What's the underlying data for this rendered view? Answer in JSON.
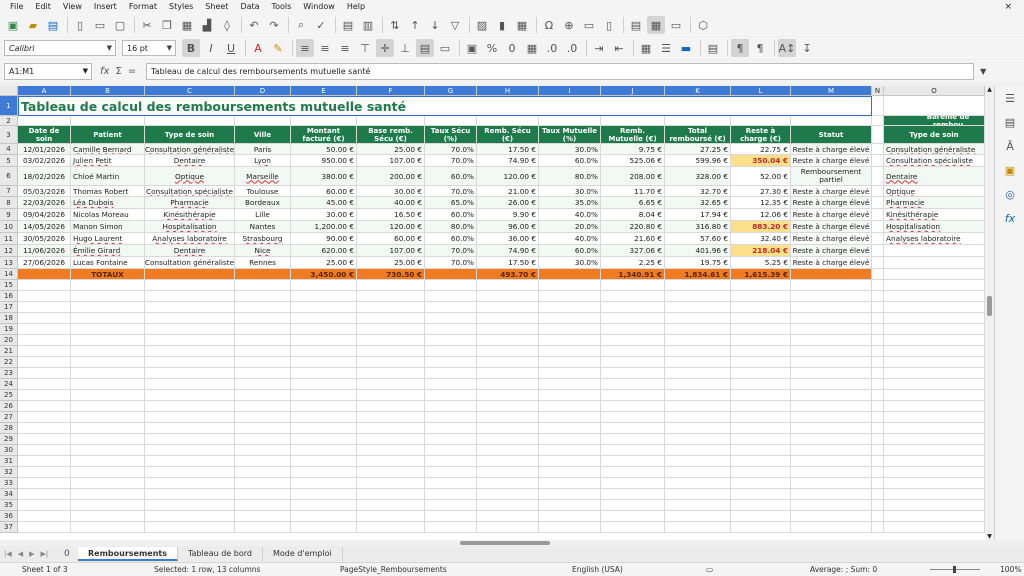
{
  "menu": [
    "File",
    "Edit",
    "View",
    "Insert",
    "Format",
    "Styles",
    "Sheet",
    "Data",
    "Tools",
    "Window",
    "Help"
  ],
  "menu_close": "×",
  "font_name": "Calibri",
  "font_size": "16 pt",
  "name_box": "A1:M1",
  "formula": "Tableau de calcul des remboursements mutuelle santé",
  "formula_icons": {
    "function_wizard": "fx",
    "sum": "Σ",
    "equals": "="
  },
  "columns": [
    "A",
    "B",
    "C",
    "D",
    "E",
    "F",
    "G",
    "H",
    "I",
    "J",
    "K",
    "L",
    "M",
    "N",
    "O"
  ],
  "row_numbers": [
    "1",
    "2",
    "3",
    "4",
    "5",
    "6",
    "7",
    "8",
    "9",
    "10",
    "11",
    "12",
    "13",
    "14",
    "15",
    "16",
    "17",
    "18",
    "19",
    "20",
    "21",
    "22",
    "23",
    "24",
    "25",
    "26",
    "27",
    "28",
    "29",
    "30",
    "31",
    "32",
    "33",
    "34",
    "35",
    "36",
    "37"
  ],
  "title": "Tableau de calcul des remboursements mutuelle santé",
  "headers": [
    "Date de soin",
    "Patient",
    "Type de soin",
    "Ville",
    "Montant facturé (€)",
    "Base remb. Sécu (€)",
    "Taux Sécu (%)",
    "Remb. Sécu (€)",
    "Taux Mutuelle (%)",
    "Remb. Mutuelle (€)",
    "Total remboursé (€)",
    "Reste à charge (€)",
    "Statut"
  ],
  "rows": [
    [
      "12/01/2026",
      "Camille Bernard",
      "Consultation généraliste",
      "Paris",
      "50.00 €",
      "25.00 €",
      "70.0%",
      "17.50 €",
      "30.0%",
      "9.75 €",
      "27.25 €",
      "22.75 €",
      "Reste à charge élevé"
    ],
    [
      "03/02/2026",
      "Julien Petit",
      "Dentaire",
      "Lyon",
      "950.00 €",
      "107.00 €",
      "70.0%",
      "74.90 €",
      "60.0%",
      "525.06 €",
      "599.96 €",
      "350.04 €",
      "Reste à charge élevé"
    ],
    [
      "18/02/2026",
      "Chloé Martin",
      "Optique",
      "Marseille",
      "380.00 €",
      "200.00 €",
      "60.0%",
      "120.00 €",
      "80.0%",
      "208.00 €",
      "328.00 €",
      "52.00 €",
      "Remboursement partiel"
    ],
    [
      "05/03/2026",
      "Thomas Robert",
      "Consultation spécialiste",
      "Toulouse",
      "60.00 €",
      "30.00 €",
      "70.0%",
      "21.00 €",
      "30.0%",
      "11.70 €",
      "32.70 €",
      "27.30 €",
      "Reste à charge élevé"
    ],
    [
      "22/03/2026",
      "Léa Dubois",
      "Pharmacie",
      "Bordeaux",
      "45.00 €",
      "40.00 €",
      "65.0%",
      "26.00 €",
      "35.0%",
      "6.65 €",
      "32.65 €",
      "12.35 €",
      "Reste à charge élevé"
    ],
    [
      "09/04/2026",
      "Nicolas Moreau",
      "Kinésithérapie",
      "Lille",
      "30.00 €",
      "16.50 €",
      "60.0%",
      "9.90 €",
      "40.0%",
      "8.04 €",
      "17.94 €",
      "12.06 €",
      "Reste à charge élevé"
    ],
    [
      "14/05/2026",
      "Manon Simon",
      "Hospitalisation",
      "Nantes",
      "1,200.00 €",
      "120.00 €",
      "80.0%",
      "96.00 €",
      "20.0%",
      "220.80 €",
      "316.80 €",
      "883.20 €",
      "Reste à charge élevé"
    ],
    [
      "30/05/2026",
      "Hugo Laurent",
      "Analyses laboratoire",
      "Strasbourg",
      "90.00 €",
      "60.00 €",
      "60.0%",
      "36.00 €",
      "40.0%",
      "21.60 €",
      "57.60 €",
      "32.40 €",
      "Reste à charge élevé"
    ],
    [
      "11/06/2026",
      "Émilie Girard",
      "Dentaire",
      "Nice",
      "620.00 €",
      "107.00 €",
      "70.0%",
      "74.90 €",
      "60.0%",
      "327.06 €",
      "401.96 €",
      "218.04 €",
      "Reste à charge élevé"
    ],
    [
      "27/06/2026",
      "Lucas Fontaine",
      "Consultation généraliste",
      "Rennes",
      "25.00 €",
      "25.00 €",
      "70.0%",
      "17.50 €",
      "30.0%",
      "2.25 €",
      "19.75 €",
      "5.25 €",
      "Reste à charge élevé"
    ]
  ],
  "totals": {
    "label": "TOTAUX",
    "montant": "3,450.00 €",
    "base": "730.50 €",
    "secu": "493.70 €",
    "mutuelle": "1,340.91 €",
    "total": "1,834.61 €",
    "reste": "1,615.39 €"
  },
  "bareme": {
    "title": "Barème de rembou",
    "header": "Type de soin",
    "items": [
      "Consultation généraliste",
      "Consultation spécialiste",
      "Dentaire",
      "Optique",
      "Pharmacie",
      "Kinésithérapie",
      "Hospitalisation",
      "Analyses laboratoire"
    ]
  },
  "tabs": [
    "Remboursements",
    "Tableau de bord",
    "Mode d'emploi"
  ],
  "tab_counter": "0",
  "status": {
    "sheet": "Sheet 1 of 3",
    "selection": "Selected: 1 row, 13 columns",
    "pagestyle": "PageStyle_Remboursements",
    "language": "English (USA)",
    "summary": "Average: ; Sum: 0",
    "zoom": "100%"
  },
  "colors": {
    "header_green": "#1f7a4b",
    "total_orange": "#ef7b22",
    "warn_yellow": "#fde08a",
    "selection_blue": "#3d7bd6"
  }
}
